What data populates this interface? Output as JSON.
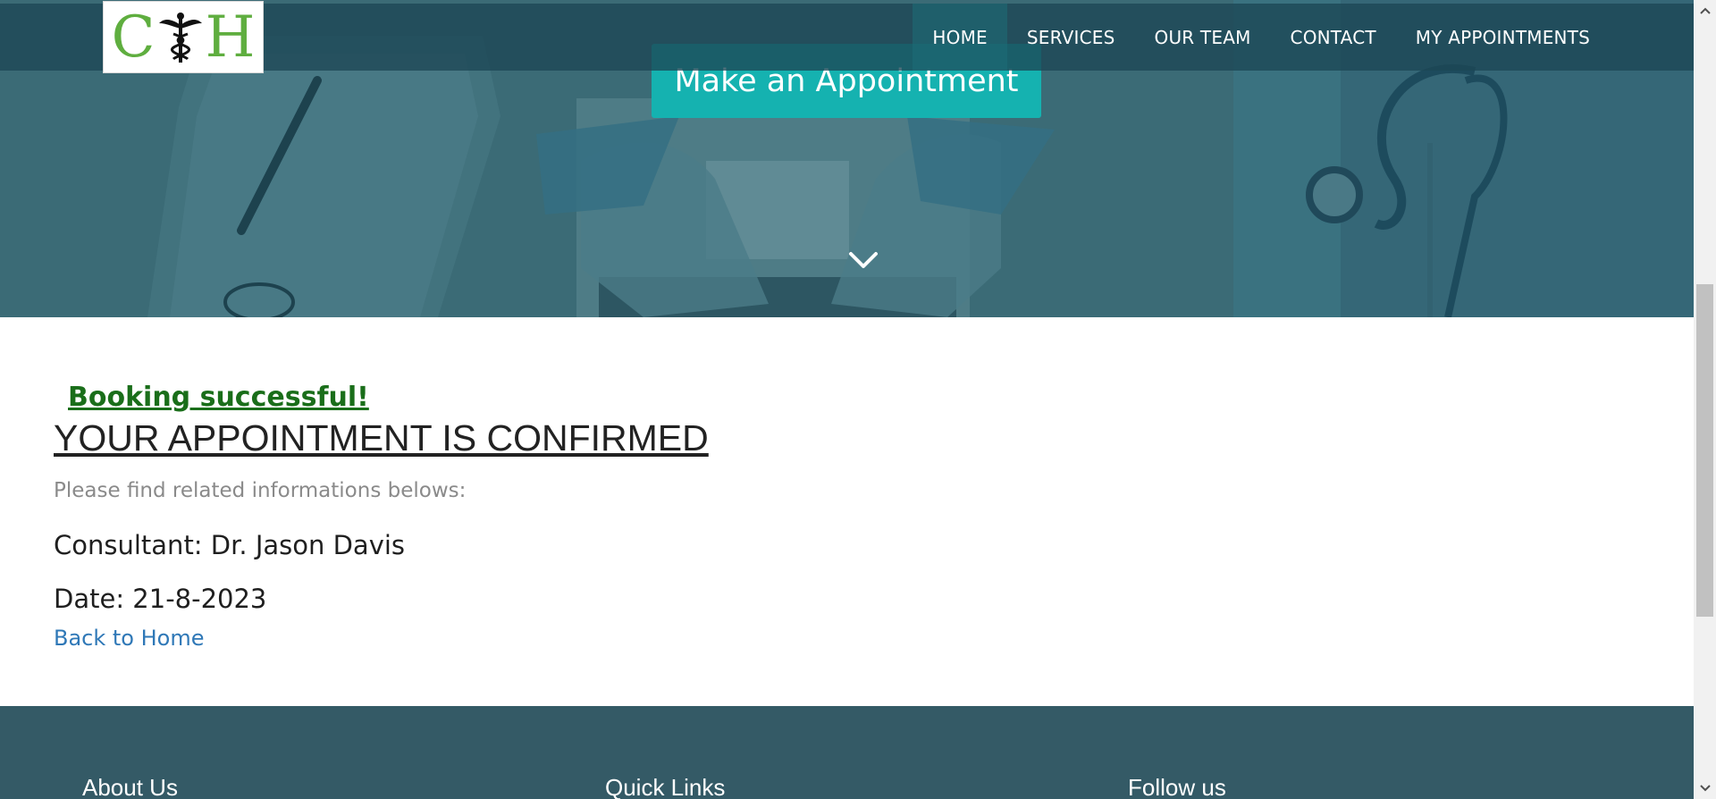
{
  "logo": {
    "left_letter": "C",
    "right_letter": "H",
    "icon": "caduceus-icon"
  },
  "nav": {
    "items": [
      "HOME",
      "SERVICES",
      "OUR TEAM",
      "CONTACT",
      "MY APPOINTMENTS"
    ],
    "active": "HOME"
  },
  "hero": {
    "cta_label": "Make an Appointment",
    "scroll_icon": "chevron-down-icon"
  },
  "confirmation": {
    "success_message": "Booking successful!",
    "heading": "YOUR APPOINTMENT IS CONFIRMED",
    "info_line": "Please find related informations belows:",
    "consultant_line": "Consultant: Dr. Jason Davis",
    "date_line": "Date: 21-8-2023",
    "back_link": "Back to Home"
  },
  "footer": {
    "columns": [
      "About Us",
      "Quick Links",
      "Follow us"
    ]
  },
  "colors": {
    "nav_bg": "#1c4655",
    "cta": "#15b2b0",
    "success": "#1a6e1a",
    "link": "#2f78b7",
    "footer_bg": "#345a66",
    "logo_green": "#5fae3f"
  }
}
